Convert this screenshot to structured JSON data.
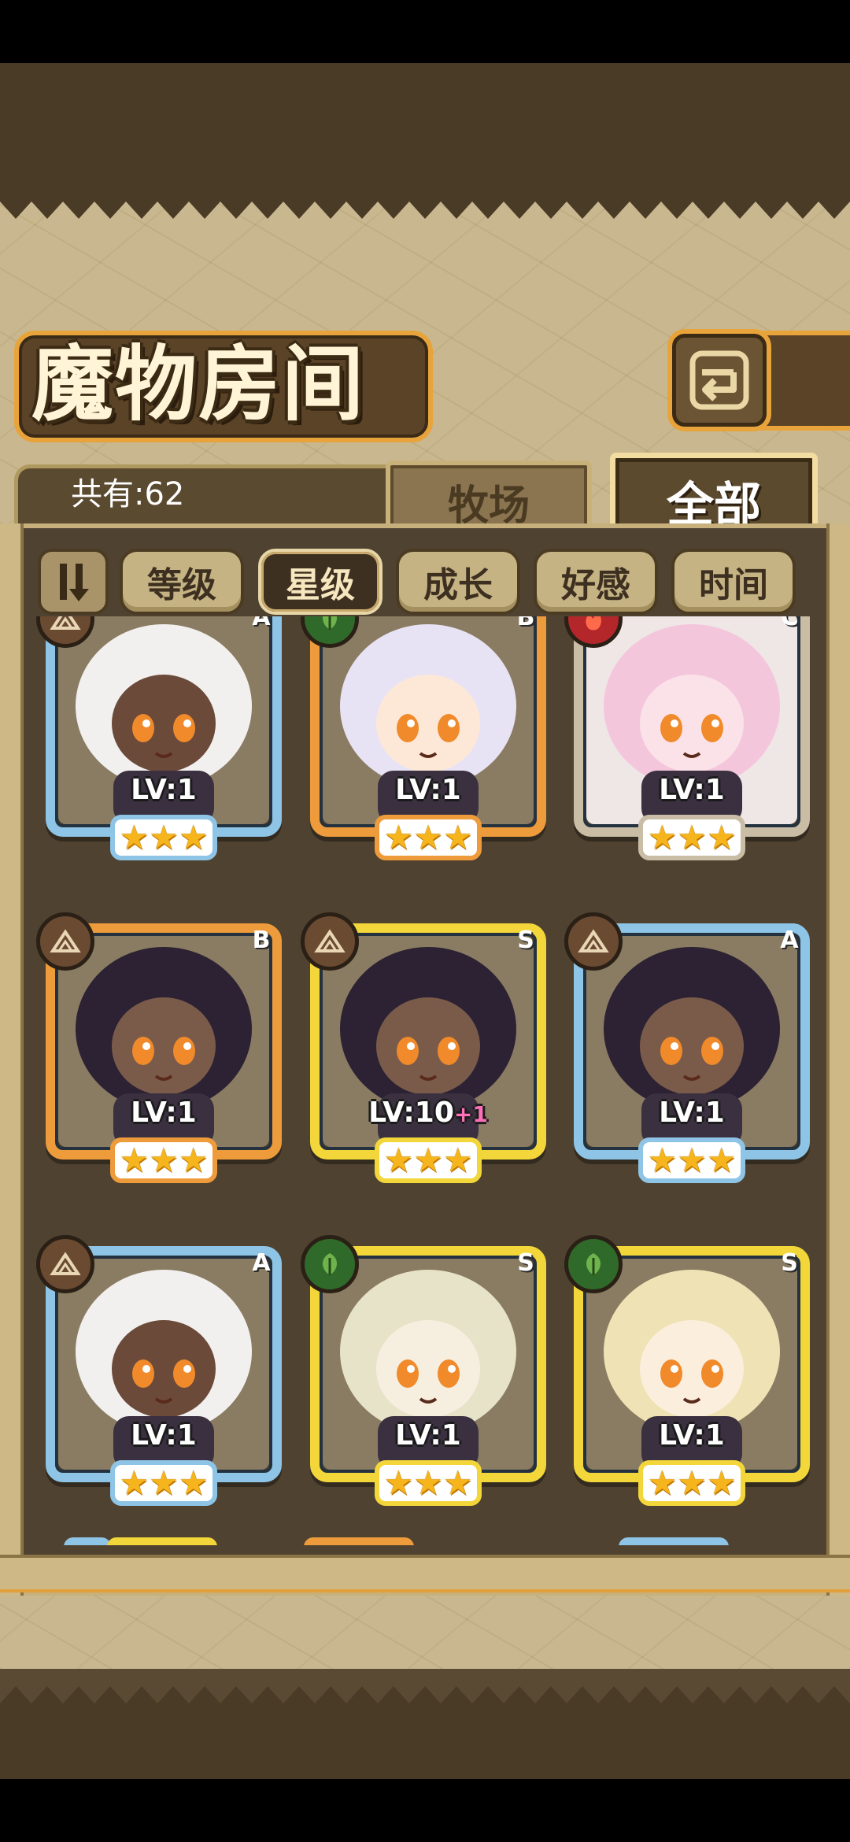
{
  "header": {
    "title": "魔物房间"
  },
  "count": {
    "text": "共有:62"
  },
  "tabs": {
    "ranch": "牧场",
    "all": "全部"
  },
  "sort": {
    "buttons": [
      {
        "label": "等级",
        "active": false
      },
      {
        "label": "星级",
        "active": true
      },
      {
        "label": "成长",
        "active": false
      },
      {
        "label": "好感",
        "active": false
      },
      {
        "label": "时间",
        "active": false
      }
    ]
  },
  "monsters": [
    {
      "rank": "A",
      "element": "earth",
      "level": "LV:1",
      "bonus": "",
      "stars": 3,
      "frame": "blue",
      "skin": "#6b4a3a",
      "hair": "#f2f0ee"
    },
    {
      "rank": "B",
      "element": "wind",
      "level": "LV:1",
      "bonus": "",
      "stars": 3,
      "frame": "orange",
      "skin": "#fde8d8",
      "hair": "#e8e3f4"
    },
    {
      "rank": "C",
      "element": "fire",
      "level": "LV:1",
      "bonus": "",
      "stars": 3,
      "frame": "grey",
      "skin": "#fbe2e8",
      "hair": "#f4c6dc"
    },
    {
      "rank": "B",
      "element": "earth",
      "level": "LV:1",
      "bonus": "",
      "stars": 3,
      "frame": "orange",
      "skin": "#7a5b4a",
      "hair": "#2c2233"
    },
    {
      "rank": "S",
      "element": "earth",
      "level": "LV:10",
      "bonus": "+1",
      "stars": 3,
      "frame": "yellow",
      "skin": "#7a5b4a",
      "hair": "#2c2233"
    },
    {
      "rank": "A",
      "element": "earth",
      "level": "LV:1",
      "bonus": "",
      "stars": 3,
      "frame": "blue",
      "skin": "#7a5b4a",
      "hair": "#2c2233"
    },
    {
      "rank": "A",
      "element": "earth",
      "level": "LV:1",
      "bonus": "",
      "stars": 3,
      "frame": "blue",
      "skin": "#6b4a3a",
      "hair": "#f2f0ee"
    },
    {
      "rank": "S",
      "element": "wind",
      "level": "LV:1",
      "bonus": "",
      "stars": 3,
      "frame": "yellow",
      "skin": "#f6efe0",
      "hair": "#e7e3c8"
    },
    {
      "rank": "S",
      "element": "wind",
      "level": "LV:1",
      "bonus": "",
      "stars": 3,
      "frame": "yellow",
      "skin": "#fbeedc",
      "hair": "#efe2b4"
    }
  ],
  "colors": {
    "frame_blue": "#8ec4e6",
    "frame_orange": "#ee9b3c",
    "frame_yellow": "#f2d63a",
    "frame_grey": "#c9bda6",
    "element_earth": "#6b4a32",
    "element_wind": "#2f6a2a",
    "element_fire": "#b3262a",
    "accent": "#e8a33b"
  },
  "icons": {
    "back": "return-arrow-icon",
    "sort_toggle": "sort-order-icon"
  }
}
